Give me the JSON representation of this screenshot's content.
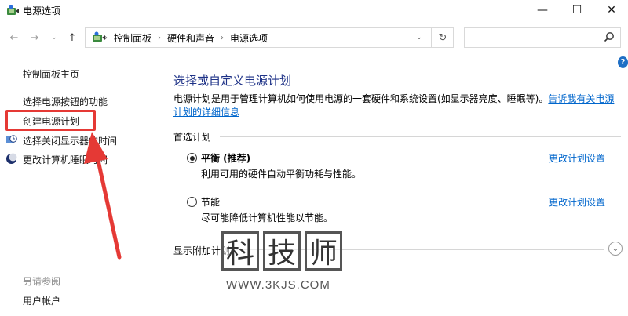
{
  "window": {
    "title": "电源选项",
    "minimize_glyph": "—",
    "maximize_glyph": "☐",
    "close_glyph": "✕"
  },
  "nav": {
    "back_glyph": "←",
    "forward_glyph": "→",
    "dropdown_glyph": "⌄",
    "up_glyph": "↑"
  },
  "address": {
    "breadcrumbs": [
      "控制面板",
      "硬件和声音",
      "电源选项"
    ],
    "separator": "›",
    "dropdown_glyph": "⌄",
    "refresh_glyph": "↻"
  },
  "search": {
    "placeholder": "",
    "icon": "search-icon"
  },
  "help": {
    "glyph": "?"
  },
  "sidebar": {
    "home": "控制面板主页",
    "items": [
      {
        "label": "选择电源按钮的功能",
        "icon": ""
      },
      {
        "label": "创建电源计划",
        "icon": ""
      },
      {
        "label": "选择关闭显示器的时间",
        "icon": "clock-monitor-icon"
      },
      {
        "label": "更改计算机睡眠时间",
        "icon": "moon-icon"
      }
    ],
    "see_also": "另请参阅",
    "see_also_items": [
      "用户帐户"
    ]
  },
  "main": {
    "title": "选择或自定义电源计划",
    "description": "电源计划是用于管理计算机如何使用电源的一套硬件和系统设置(如显示器亮度、睡眠等)。",
    "description_link": "告诉我有关电源计划的详细信息",
    "preferred_section": "首选计划",
    "plans": [
      {
        "name": "平衡 (推荐)",
        "description": "利用可用的硬件自动平衡功耗与性能。",
        "selected": true,
        "link": "更改计划设置"
      },
      {
        "name": "节能",
        "description": "尽可能降低计算机性能以节能。",
        "selected": false,
        "link": "更改计划设置"
      }
    ],
    "additional_section": "显示附加计划",
    "expand_glyph": "⌄"
  },
  "watermark": {
    "chars": [
      "科",
      "技",
      "师"
    ],
    "url": "WWW.3KJS.COM"
  },
  "colors": {
    "title_blue": "#1e3287",
    "link_blue": "#0066cc",
    "annotation_red": "#e53935"
  }
}
